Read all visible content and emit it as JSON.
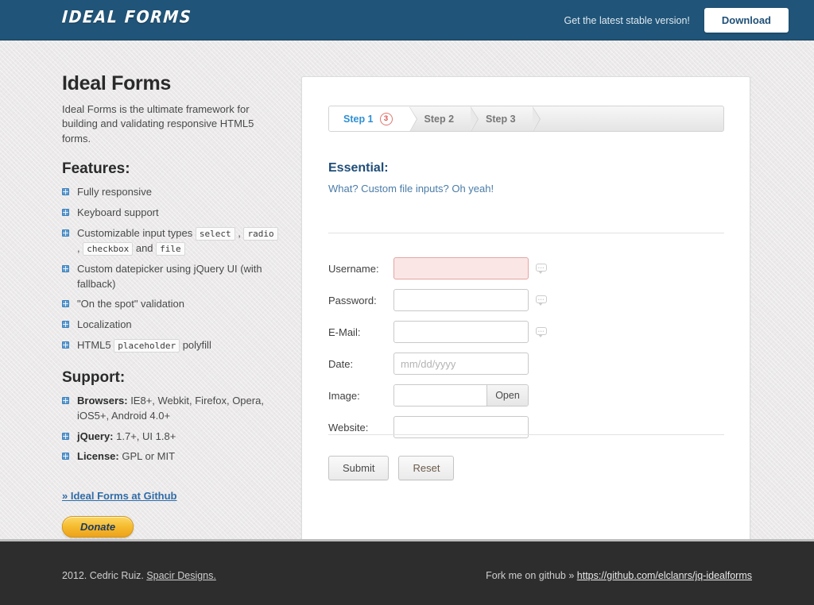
{
  "header": {
    "logo": "Ideal Forms",
    "tagline": "Get the latest stable version!",
    "download_label": "Download"
  },
  "sidebar": {
    "title": "Ideal Forms",
    "description": "Ideal Forms is the ultimate framework for building and validating responsive HTML5 forms.",
    "features_heading": "Features:",
    "features": [
      {
        "text": "Fully responsive"
      },
      {
        "text": "Keyboard support"
      },
      {
        "text_parts": [
          "Customizable input types ",
          " , ",
          " , ",
          " and ",
          ""
        ],
        "codes": [
          "select",
          "radio",
          "checkbox",
          "file"
        ]
      },
      {
        "text": "Custom datepicker using jQuery UI (with fallback)"
      },
      {
        "text": "\"On the spot\" validation"
      },
      {
        "text": "Localization"
      },
      {
        "text_parts": [
          "HTML5 ",
          " polyfill"
        ],
        "codes": [
          "placeholder"
        ]
      }
    ],
    "feature_labels": [
      "Fully responsive",
      "Keyboard support",
      "Customizable input types",
      "Custom datepicker using jQuery UI (with fallback)",
      "\"On the spot\" validation",
      "Localization",
      "HTML5 placeholder polyfill"
    ],
    "feature3": {
      "prefix": "Customizable input types ",
      "code1": "select",
      "sep1": " , ",
      "code2": "radio",
      "sep2": " ,",
      "code3": "checkbox",
      "sep3": " and ",
      "code4": "file"
    },
    "feature7": {
      "prefix": "HTML5 ",
      "code": "placeholder",
      "suffix": " polyfill"
    },
    "support_heading": "Support:",
    "support": [
      {
        "label": "Browsers:",
        "value": " IE8+, Webkit, Firefox, Opera, iOS5+, Android 4.0+"
      },
      {
        "label": "jQuery:",
        "value": " 1.7+, UI 1.8+"
      },
      {
        "label": "License:",
        "value": " GPL or MIT"
      }
    ],
    "github_link": "» Ideal Forms at Github",
    "donate_label": "Donate"
  },
  "form": {
    "steps": [
      {
        "label": "Step 1",
        "badge": "3",
        "active": true
      },
      {
        "label": "Step 2",
        "badge": "",
        "active": false
      },
      {
        "label": "Step 3",
        "badge": "",
        "active": false
      }
    ],
    "heading": "Essential:",
    "subheading": "What? Custom file inputs? Oh yeah!",
    "fields": [
      {
        "label": "Username:",
        "value": "",
        "placeholder": "",
        "type": "text",
        "state": "error"
      },
      {
        "label": "Password:",
        "value": "",
        "placeholder": "",
        "type": "password",
        "state": "normal"
      },
      {
        "label": "E-Mail:",
        "value": "",
        "placeholder": "",
        "type": "text",
        "state": "normal"
      },
      {
        "label": "Date:",
        "value": "",
        "placeholder": "mm/dd/yyyy",
        "type": "text",
        "state": "normal"
      },
      {
        "label": "Image:",
        "value": "",
        "placeholder": "",
        "type": "file",
        "state": "normal",
        "button": "Open"
      },
      {
        "label": "Website:",
        "value": "",
        "placeholder": "",
        "type": "text",
        "state": "normal"
      }
    ],
    "submit_label": "Submit",
    "reset_label": "Reset"
  },
  "footer": {
    "copyright": "2012. Cedric Ruiz. ",
    "author_link": "Spacir Designs.",
    "fork_text": "Fork me on github » ",
    "fork_link": "https://github.com/elclanrs/jq-idealforms"
  },
  "colors": {
    "header_blue": "#205478",
    "accent_blue": "#2f8fd4",
    "heading_navy": "#1f4e79",
    "error_red": "#d9534f",
    "footer_dark": "#2d2d2d"
  }
}
